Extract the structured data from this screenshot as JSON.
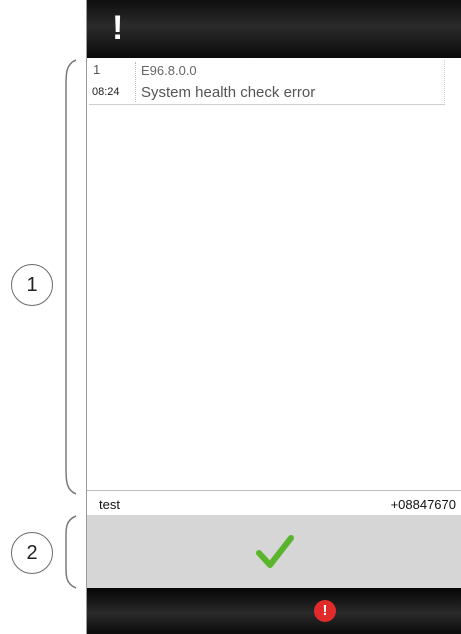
{
  "header": {
    "alert_symbol": "!"
  },
  "events": [
    {
      "index": "1",
      "time": "08:24",
      "code": "E96.8.0.0",
      "message": "System health check error"
    }
  ],
  "footer": {
    "name": "test",
    "value": "+08847670"
  },
  "confirm": {
    "icon": "checkmark-icon",
    "color": "#5ab52d"
  },
  "status": {
    "icon": "error-alert-icon",
    "symbol": "!",
    "color": "#e12b2b"
  },
  "callouts": [
    "1",
    "2"
  ]
}
